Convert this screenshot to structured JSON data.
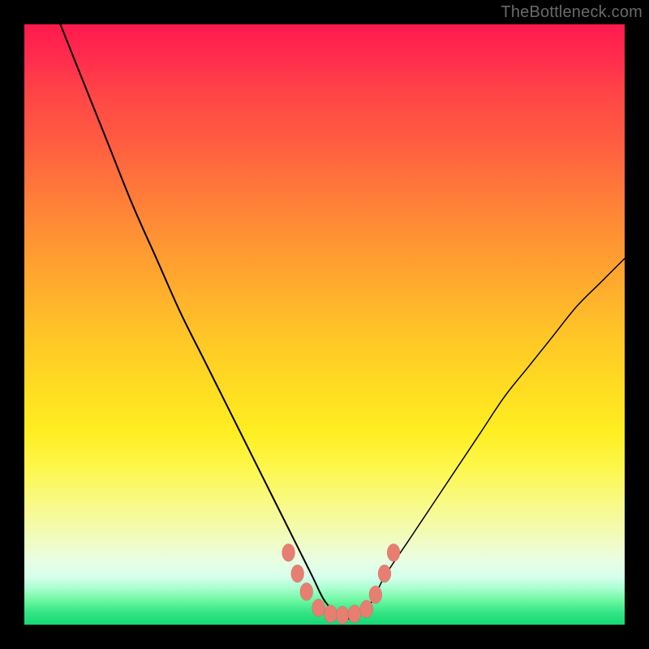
{
  "watermark": {
    "text": "TheBottleneck.com"
  },
  "chart_data": {
    "type": "line",
    "title": "",
    "xlabel": "",
    "ylabel": "",
    "xlim": [
      0,
      100
    ],
    "ylim": [
      0,
      100
    ],
    "grid": false,
    "series": [
      {
        "name": "bottleneck-curve",
        "x": [
          6,
          10,
          14,
          18,
          22,
          26,
          30,
          34,
          38,
          42,
          44,
          46,
          48,
          50,
          52,
          54,
          56,
          58,
          60,
          64,
          68,
          72,
          76,
          80,
          84,
          88,
          92,
          96,
          100
        ],
        "y": [
          100,
          90,
          80,
          70,
          61,
          52,
          44,
          36,
          28,
          20,
          16,
          12,
          8,
          4,
          2,
          1,
          2,
          4,
          8,
          14,
          20,
          26,
          32,
          38,
          43,
          48,
          53,
          57,
          61
        ]
      }
    ],
    "markers": {
      "name": "optimal-band-markers",
      "points": [
        {
          "x": 44.0,
          "y": 12.0
        },
        {
          "x": 45.5,
          "y": 8.5
        },
        {
          "x": 47.0,
          "y": 5.5
        },
        {
          "x": 49.0,
          "y": 2.8
        },
        {
          "x": 51.0,
          "y": 1.8
        },
        {
          "x": 53.0,
          "y": 1.6
        },
        {
          "x": 55.0,
          "y": 1.8
        },
        {
          "x": 57.0,
          "y": 2.6
        },
        {
          "x": 58.5,
          "y": 5.0
        },
        {
          "x": 60.0,
          "y": 8.5
        },
        {
          "x": 61.5,
          "y": 12.0
        }
      ]
    },
    "background_gradient": {
      "direction": "top-to-bottom",
      "stops": [
        {
          "pos": 0.0,
          "color": "#ff1a4d"
        },
        {
          "pos": 0.5,
          "color": "#ffc627"
        },
        {
          "pos": 0.8,
          "color": "#f8fa88"
        },
        {
          "pos": 1.0,
          "color": "#16d873"
        }
      ]
    }
  }
}
